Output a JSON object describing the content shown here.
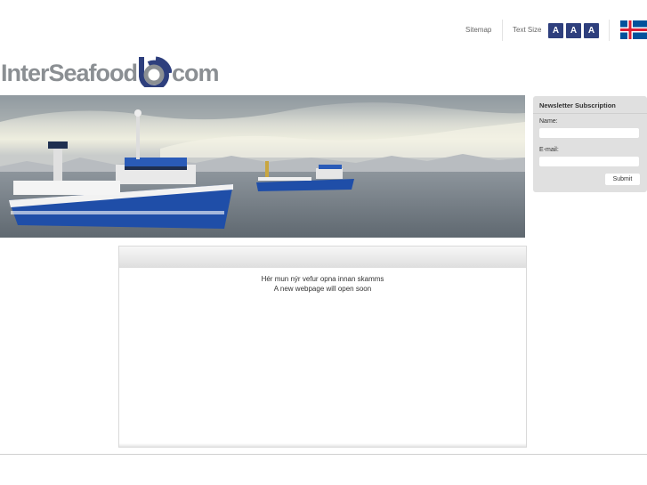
{
  "header": {
    "sitemap_label": "Sitemap",
    "textsize_label": "Text Size",
    "textsize_buttons": [
      "A",
      "A",
      "A"
    ],
    "language_icon": "iceland-flag-icon"
  },
  "logo": {
    "left_text": "InterSeafood",
    "right_text": "com",
    "brand_color": "#8b8f93",
    "mark_color": "#2e3f7d"
  },
  "newsletter": {
    "title": "Newsletter Subscription",
    "name_label": "Name:",
    "name_value": "",
    "email_label": "E-mail:",
    "email_value": "",
    "submit_label": "Submit"
  },
  "content": {
    "message_is": "Hér mun nýr vefur opna innan skamms",
    "message_en": "A new webpage will open soon"
  },
  "colors": {
    "accent": "#2e3f7d",
    "panel": "#e0e0e0"
  }
}
